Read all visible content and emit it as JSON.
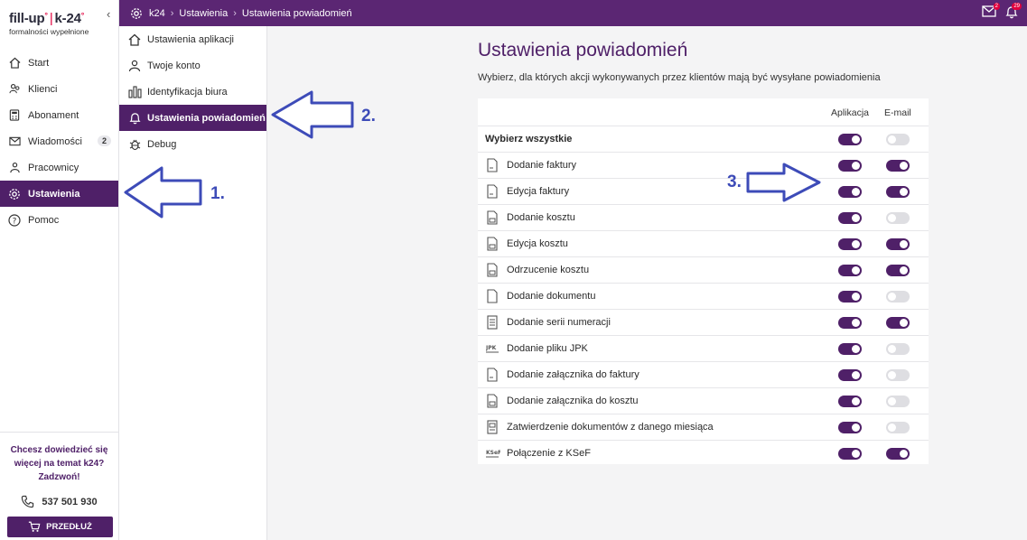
{
  "brand": {
    "name": "fill-up",
    "trademark": "°",
    "name2": "k-24",
    "tagline": "formalności wypełnione"
  },
  "sidebar": {
    "items": [
      {
        "label": "Start",
        "icon": "home-icon"
      },
      {
        "label": "Klienci",
        "icon": "users-icon"
      },
      {
        "label": "Abonament",
        "icon": "calculator-icon"
      },
      {
        "label": "Wiadomości",
        "icon": "mail-icon",
        "badge": "2"
      },
      {
        "label": "Pracownicy",
        "icon": "team-icon"
      },
      {
        "label": "Ustawienia",
        "icon": "gear-icon",
        "active": true
      },
      {
        "label": "Pomoc",
        "icon": "help-icon"
      }
    ],
    "promo_text": "Chcesz dowiedzieć się więcej na temat k24? Zadzwoń!",
    "phone": "537 501 930",
    "renew_label": "PRZEDŁUŻ"
  },
  "topbar": {
    "breadcrumb": [
      "k24",
      "Ustawienia",
      "Ustawienia powiadomień"
    ],
    "notifications": {
      "mail_badge": "2",
      "bell_badge": "29"
    }
  },
  "submenu": {
    "items": [
      {
        "label": "Ustawienia aplikacji",
        "icon": "house-icon"
      },
      {
        "label": "Twoje konto",
        "icon": "person-icon"
      },
      {
        "label": "Identyfikacja biura",
        "icon": "building-icon"
      },
      {
        "label": "Ustawienia powiadomień",
        "icon": "bell-icon",
        "active": true
      },
      {
        "label": "Debug",
        "icon": "bug-icon"
      }
    ]
  },
  "main": {
    "title": "Ustawienia powiadomień",
    "description": "Wybierz, dla których akcji wykonywanych przez klientów mają być wysyłane powiadomienia",
    "columns": {
      "app": "Aplikacja",
      "email": "E-mail"
    },
    "select_all": {
      "label": "Wybierz wszystkie",
      "app": true,
      "email": false
    },
    "rows": [
      {
        "label": "Dodanie faktury",
        "icon": "invoice-icon",
        "app": true,
        "email": true
      },
      {
        "label": "Edycja faktury",
        "icon": "invoice-icon",
        "app": true,
        "email": true
      },
      {
        "label": "Dodanie kosztu",
        "icon": "cost-document-icon",
        "app": true,
        "email": false
      },
      {
        "label": "Edycja kosztu",
        "icon": "cost-document-icon",
        "app": true,
        "email": true
      },
      {
        "label": "Odrzucenie kosztu",
        "icon": "cost-document-icon",
        "app": true,
        "email": true
      },
      {
        "label": "Dodanie dokumentu",
        "icon": "document-icon",
        "app": true,
        "email": false
      },
      {
        "label": "Dodanie serii numeracji",
        "icon": "list-document-icon",
        "app": true,
        "email": true
      },
      {
        "label": "Dodanie pliku JPK",
        "icon": "jpk-icon",
        "icon_text": "JPK",
        "app": true,
        "email": false
      },
      {
        "label": "Dodanie załącznika do faktury",
        "icon": "invoice-icon",
        "app": true,
        "email": false
      },
      {
        "label": "Dodanie załącznika do kosztu",
        "icon": "cost-document-icon",
        "app": true,
        "email": false
      },
      {
        "label": "Zatwierdzenie dokumentów z danego miesiąca",
        "icon": "approve-document-icon",
        "app": true,
        "email": false
      },
      {
        "label": "Połączenie z KSeF",
        "icon": "ksef-icon",
        "icon_text": "KSeF",
        "app": true,
        "email": true
      }
    ]
  },
  "annotations": [
    "1.",
    "2.",
    "3."
  ],
  "colors": {
    "primary": "#4f2068",
    "topbar": "#5b2673",
    "annotation": "#3d4bb8",
    "toggle_off": "#dedee2"
  }
}
